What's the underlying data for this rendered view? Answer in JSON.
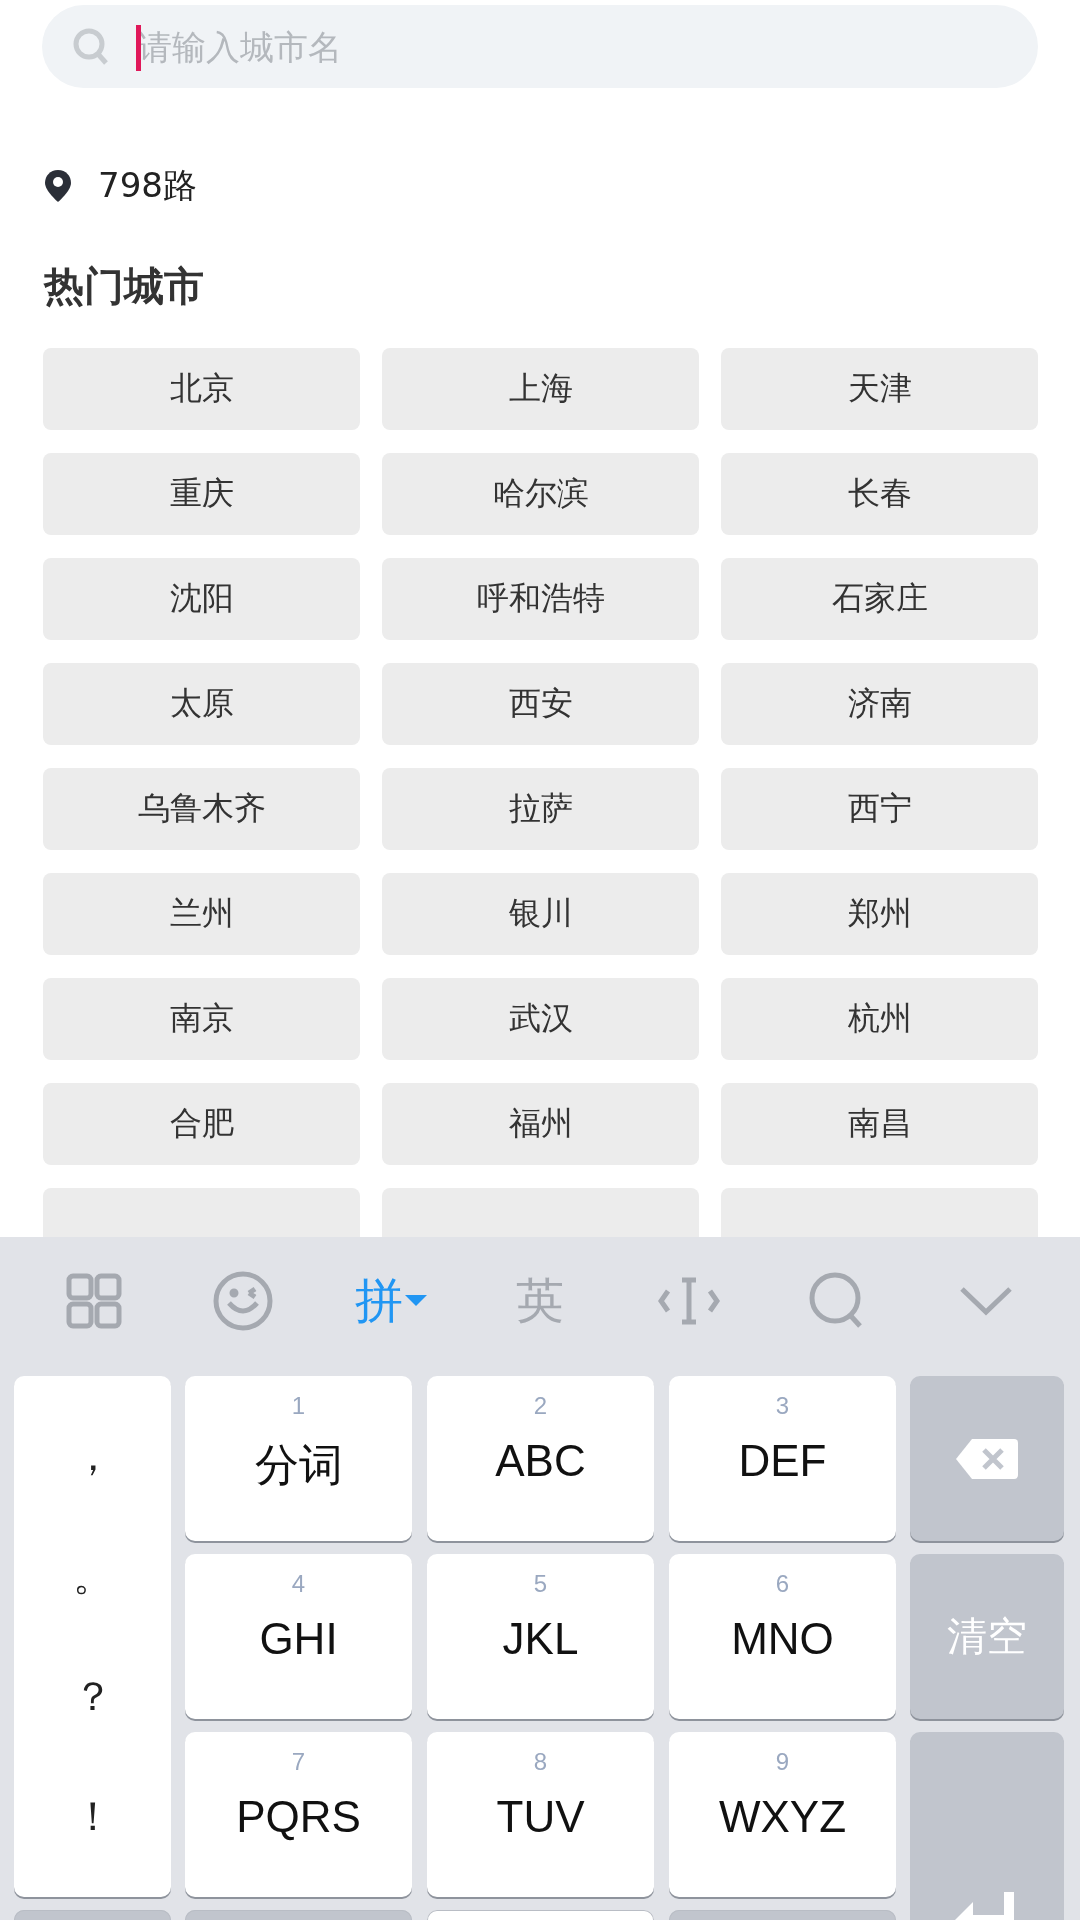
{
  "search": {
    "placeholder": "请输入城市名"
  },
  "location": {
    "label": "798路"
  },
  "hot_cities": {
    "title": "热门城市",
    "cities": [
      {
        "kind": "city",
        "label": "北京"
      },
      {
        "kind": "city",
        "label": "上海"
      },
      {
        "kind": "city",
        "label": "天津"
      },
      {
        "kind": "city",
        "label": "重庆"
      },
      {
        "kind": "city",
        "label": "哈尔滨"
      },
      {
        "kind": "city",
        "label": "长春"
      },
      {
        "kind": "city",
        "label": "沈阳"
      },
      {
        "kind": "city",
        "label": "呼和浩特"
      },
      {
        "kind": "city",
        "label": "石家庄"
      },
      {
        "kind": "city",
        "label": "太原"
      },
      {
        "kind": "city",
        "label": "西安"
      },
      {
        "kind": "city",
        "label": "济南"
      },
      {
        "kind": "city",
        "label": "乌鲁木齐"
      },
      {
        "kind": "city",
        "label": "拉萨"
      },
      {
        "kind": "city",
        "label": "西宁"
      },
      {
        "kind": "city",
        "label": "兰州"
      },
      {
        "kind": "city",
        "label": "银川"
      },
      {
        "kind": "city",
        "label": "郑州"
      },
      {
        "kind": "city",
        "label": "南京"
      },
      {
        "kind": "city",
        "label": "武汉"
      },
      {
        "kind": "city",
        "label": "杭州"
      },
      {
        "kind": "city",
        "label": "合肥"
      },
      {
        "kind": "city",
        "label": "福州"
      },
      {
        "kind": "city",
        "label": "南昌"
      },
      {
        "kind": "covered"
      },
      {
        "kind": "covered"
      },
      {
        "kind": "covered"
      }
    ]
  },
  "keyboard": {
    "toolbar": [
      {
        "kind": "grid"
      },
      {
        "kind": "emoji"
      },
      {
        "kind": "mode",
        "label": "拼",
        "selected": true
      },
      {
        "kind": "mode",
        "label": "英",
        "selected": false
      },
      {
        "kind": "cursor"
      },
      {
        "kind": "search"
      },
      {
        "kind": "collapse"
      }
    ],
    "punctuation": [
      "，",
      "。",
      "？",
      "！"
    ],
    "keys": [
      {
        "number": "1",
        "letters": "分词"
      },
      {
        "number": "2",
        "letters": "ABC"
      },
      {
        "number": "3",
        "letters": "DEF"
      },
      {
        "number": "4",
        "letters": "GHI"
      },
      {
        "number": "5",
        "letters": "JKL"
      },
      {
        "number": "6",
        "letters": "MNO"
      },
      {
        "number": "7",
        "letters": "PQRS"
      },
      {
        "number": "8",
        "letters": "TUV"
      },
      {
        "number": "9",
        "letters": "WXYZ"
      }
    ],
    "side_keys": [
      {
        "kind": "backspace"
      },
      {
        "kind": "text",
        "label": "清空"
      },
      {
        "kind": "enter"
      }
    ]
  }
}
